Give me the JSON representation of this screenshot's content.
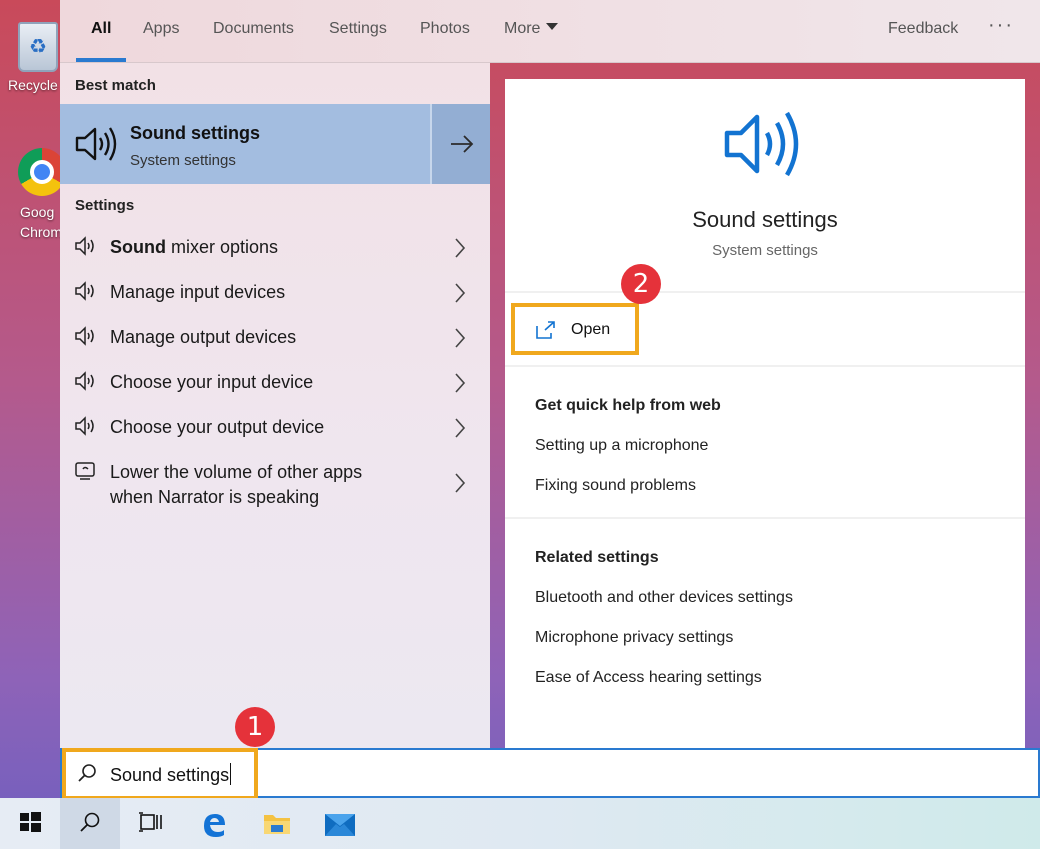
{
  "desktop": {
    "icons": [
      {
        "label": "Recycle",
        "icon": "recycle-bin-icon"
      },
      {
        "label": "Googl Chrom",
        "line1": "Goog",
        "line2": "Chrom",
        "icon": "chrome-icon"
      }
    ]
  },
  "tabs": {
    "items": [
      "All",
      "Apps",
      "Documents",
      "Settings",
      "Photos",
      "More"
    ],
    "active": "All",
    "feedback": "Feedback",
    "more_options": "···"
  },
  "results": {
    "best_match_label": "Best match",
    "best_match": {
      "title": "Sound settings",
      "subtitle": "System settings",
      "icon": "speaker-icon"
    },
    "settings_label": "Settings",
    "settings_items": [
      {
        "bold": "Sound",
        "rest": " mixer options",
        "icon": "speaker-icon"
      },
      {
        "label": "Manage input devices",
        "icon": "speaker-icon"
      },
      {
        "label": "Manage output devices",
        "icon": "speaker-icon"
      },
      {
        "label": "Choose your input device",
        "icon": "speaker-icon"
      },
      {
        "label": "Choose your output device",
        "icon": "speaker-icon"
      },
      {
        "line1": "Lower the volume of other apps",
        "line2": "when Narrator is speaking",
        "icon": "narrator-icon"
      }
    ]
  },
  "preview": {
    "title": "Sound settings",
    "subtitle": "System settings",
    "open_label": "Open",
    "help_heading": "Get quick help from web",
    "help_links": [
      "Setting up a microphone",
      "Fixing sound problems"
    ],
    "related_heading": "Related settings",
    "related_links": [
      "Bluetooth and other devices settings",
      "Microphone privacy settings",
      "Ease of Access hearing settings"
    ]
  },
  "annotations": {
    "step1": "1",
    "step2": "2",
    "highlight_color": "#f0a81d",
    "badge_color": "#e5323a"
  },
  "search": {
    "value": "Sound settings"
  },
  "taskbar": {
    "items": [
      "start-icon",
      "search-icon",
      "task-view-icon",
      "edge-icon",
      "file-explorer-icon",
      "mail-icon"
    ]
  },
  "colors": {
    "accent": "#2a7ad0",
    "selected": "#a3bde0"
  }
}
